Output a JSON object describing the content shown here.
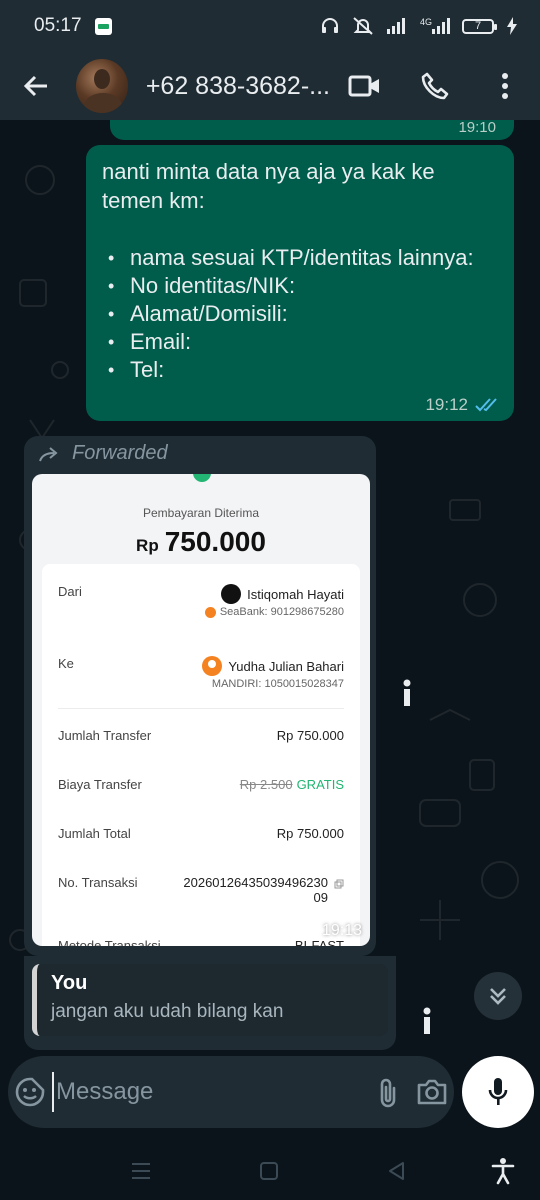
{
  "status_bar": {
    "time": "05:17",
    "network": "4G",
    "battery": "7"
  },
  "header": {
    "contact_name": "+62 838-3682-..."
  },
  "colors": {
    "outgoing_bubble": "#005c4b",
    "incoming_bubble": "#1f2c34",
    "background": "#0b141a",
    "read_ticks": "#53bdeb"
  },
  "previous_message": {
    "time": "19:10"
  },
  "message1": {
    "text": "nanti minta data nya aja ya kak ke temen km:",
    "items": [
      "nama sesuai KTP/identitas lainnya:",
      "No identitas/NIK:",
      "Alamat/Domisili:",
      "Email:",
      "Tel:"
    ],
    "time": "19:12"
  },
  "forwarded": {
    "label": "Forwarded",
    "time": "19:13",
    "receipt": {
      "title": "Pembayaran Diterima",
      "currency": "Rp",
      "amount": "750.000",
      "from_label": "Dari",
      "from_name": "Istiqomah Hayati",
      "from_account": "SeaBank: 901298675280",
      "to_label": "Ke",
      "to_name": "Yudha Julian Bahari",
      "to_account": "MANDIRI: 1050015028347",
      "transfer_label": "Jumlah Transfer",
      "transfer_value": "Rp 750.000",
      "fee_label": "Biaya Transfer",
      "fee_original": "Rp 2.500",
      "fee_value": "GRATIS",
      "total_label": "Jumlah Total",
      "total_value": "Rp 750.000",
      "trx_label": "No. Transaksi",
      "trx_value_line1": "20260126435039496230",
      "trx_value_line2": "09",
      "method_label": "Metode Transaksi",
      "method_value": "BI-FAST"
    }
  },
  "reply": {
    "author": "You",
    "text": "jangan aku udah bilang kan"
  },
  "input": {
    "placeholder": "Message"
  }
}
